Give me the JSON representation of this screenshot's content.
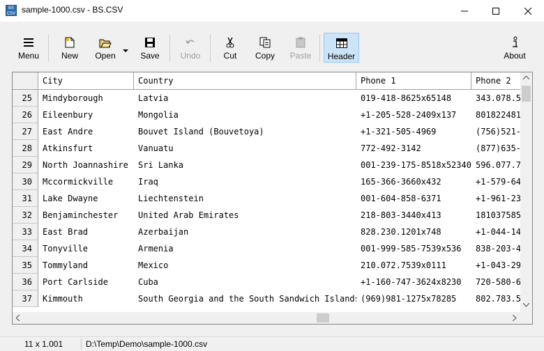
{
  "window": {
    "title": "sample-1000.csv - BS.CSV",
    "app_icon_text": "BS CSV",
    "minimize_icon": "minimize-icon",
    "maximize_icon": "maximize-icon",
    "close_icon": "close-icon"
  },
  "toolbar": {
    "menu_label": "Menu",
    "new_label": "New",
    "open_label": "Open",
    "save_label": "Save",
    "undo_label": "Undo",
    "cut_label": "Cut",
    "copy_label": "Copy",
    "paste_label": "Paste",
    "header_label": "Header",
    "about_label": "About"
  },
  "grid": {
    "columns": [
      "City",
      "Country",
      "Phone 1",
      "Phone 2"
    ],
    "rows": [
      {
        "num": "25",
        "city": "Mindyborough",
        "country": "Latvia",
        "phone1": "019-418-8625x65148",
        "phone2": "343.078.5"
      },
      {
        "num": "26",
        "city": "Eileenbury",
        "country": "Mongolia",
        "phone1": "+1-205-528-2409x137",
        "phone2": "801822481"
      },
      {
        "num": "27",
        "city": "East Andre",
        "country": "Bouvet Island (Bouvetoya)",
        "phone1": "+1-321-505-4969",
        "phone2": "(756)521-"
      },
      {
        "num": "28",
        "city": "Atkinsfurt",
        "country": "Vanuatu",
        "phone1": "772-492-3142",
        "phone2": "(877)635-"
      },
      {
        "num": "29",
        "city": "North Joannashire",
        "country": "Sri Lanka",
        "phone1": "001-239-175-8518x52340",
        "phone2": "596.077.7"
      },
      {
        "num": "30",
        "city": "Mccormickville",
        "country": "Iraq",
        "phone1": "165-366-3660x432",
        "phone2": "+1-579-64"
      },
      {
        "num": "31",
        "city": "Lake Dwayne",
        "country": "Liechtenstein",
        "phone1": "001-604-858-6371",
        "phone2": "+1-961-23"
      },
      {
        "num": "32",
        "city": "Benjaminchester",
        "country": "United Arab Emirates",
        "phone1": "218-803-3440x413",
        "phone2": "181037585"
      },
      {
        "num": "33",
        "city": "East Brad",
        "country": "Azerbaijan",
        "phone1": "828.230.1201x748",
        "phone2": "+1-044-14"
      },
      {
        "num": "34",
        "city": "Tonyville",
        "country": "Armenia",
        "phone1": "001-999-585-7539x536",
        "phone2": "838-203-4"
      },
      {
        "num": "35",
        "city": "Tommyland",
        "country": "Mexico",
        "phone1": "210.072.7539x0111",
        "phone2": "+1-043-29"
      },
      {
        "num": "36",
        "city": "Port Carlside",
        "country": "Cuba",
        "phone1": "+1-160-747-3624x8230",
        "phone2": "720-580-6"
      },
      {
        "num": "37",
        "city": "Kimmouth",
        "country": "South Georgia and the South Sandwich Islands",
        "phone1": "(969)981-1275x78285",
        "phone2": "802.783.5"
      }
    ]
  },
  "status": {
    "dimensions": "11 x 1.001",
    "path": "D:\\Temp\\Demo\\sample-1000.csv"
  }
}
